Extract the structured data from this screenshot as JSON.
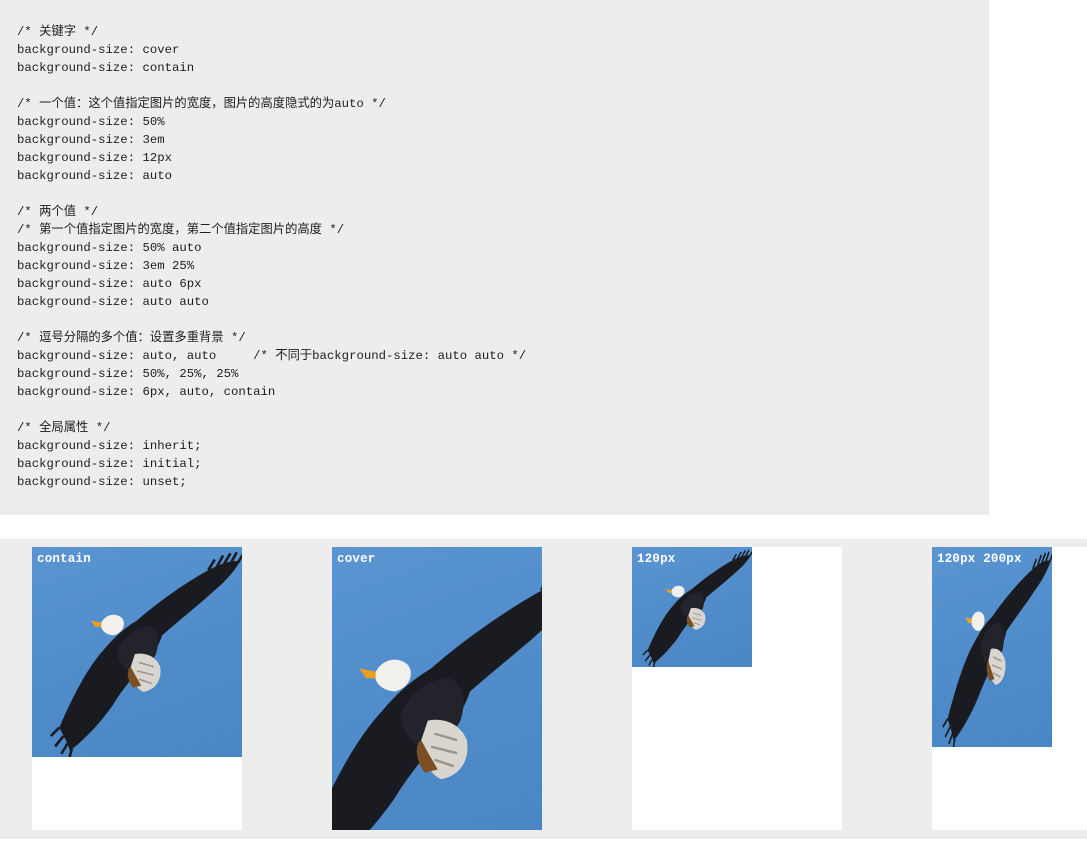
{
  "code_lines": [
    "/* 关键字 */",
    "background-size: cover",
    "background-size: contain",
    "",
    "/* 一个值：这个值指定图片的宽度，图片的高度隐式的为auto */",
    "background-size: 50%",
    "background-size: 3em",
    "background-size: 12px",
    "background-size: auto",
    "",
    "/* 两个值 */",
    "/* 第一个值指定图片的宽度，第二个值指定图片的高度 */",
    "background-size: 50% auto",
    "background-size: 3em 25%",
    "background-size: auto 6px",
    "background-size: auto auto",
    "",
    "/* 逗号分隔的多个值：设置多重背景 */",
    "background-size: auto, auto     /* 不同于background-size: auto auto */",
    "background-size: 50%, 25%, 25%",
    "background-size: 6px, auto, contain",
    "",
    "/* 全局属性 */",
    "background-size: inherit;",
    "background-size: initial;",
    "background-size: unset;"
  ],
  "demos": [
    {
      "label": "contain",
      "image": "bald-eagle-in-flight"
    },
    {
      "label": "cover",
      "image": "bald-eagle-in-flight"
    },
    {
      "label": "120px",
      "image": "bald-eagle-in-flight"
    },
    {
      "label": "120px 200px",
      "image": "bald-eagle-in-flight"
    }
  ],
  "colors": {
    "panel_bg": "#ededed",
    "sky_blue": "#4f8bc9",
    "label_text": "#ffffff",
    "code_text": "#1d1d1d"
  }
}
